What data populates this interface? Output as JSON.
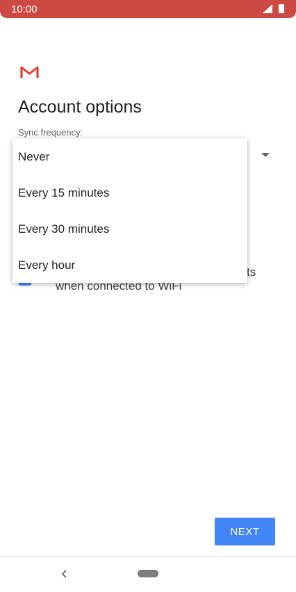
{
  "status_bar": {
    "time": "10:00"
  },
  "page": {
    "title": "Account options",
    "sync_label": "Sync frequency:"
  },
  "dropdown": {
    "options": [
      "Never",
      "Every 15 minutes",
      "Every 30 minutes",
      "Every hour"
    ]
  },
  "wifi_option": {
    "text_tail": "ts",
    "text": "when connected to WiFi",
    "checked": true
  },
  "buttons": {
    "next": "NEXT"
  },
  "colors": {
    "status_bar": "#cd4a44",
    "accent": "#4285f4",
    "gmail_red": "#d93025"
  },
  "icons": {
    "logo": "gmail-logo",
    "signal": "signal-icon",
    "battery": "battery-icon",
    "back": "back-icon"
  }
}
